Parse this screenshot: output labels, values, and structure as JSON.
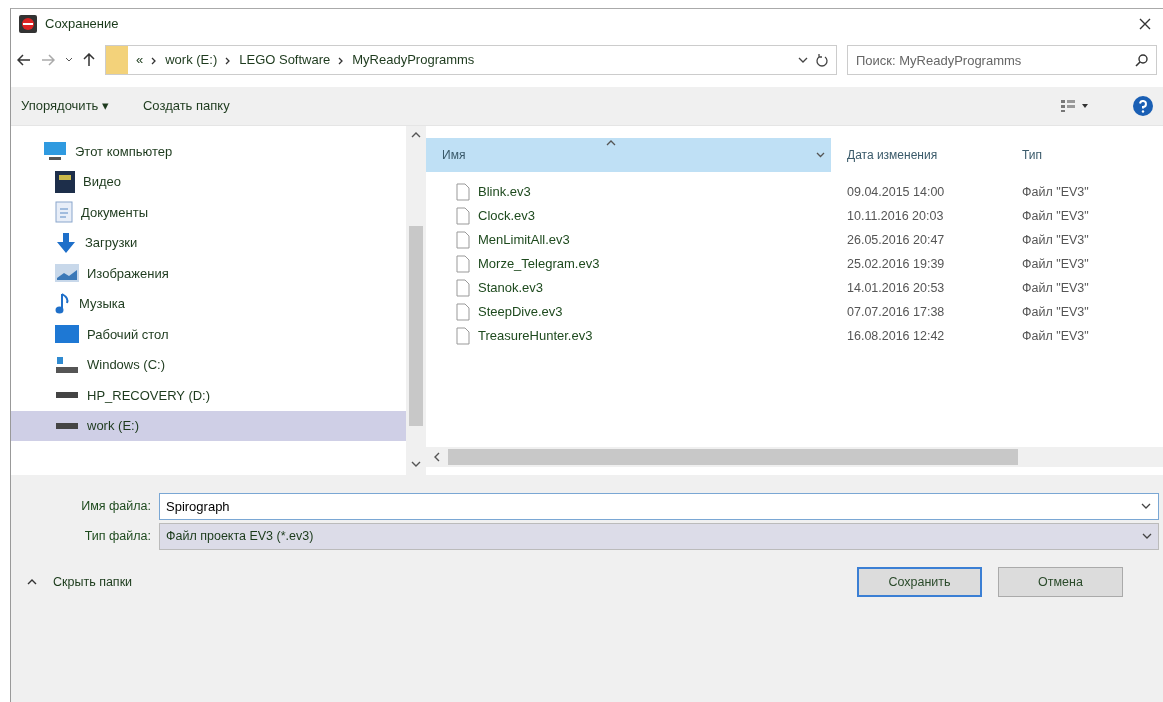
{
  "window": {
    "title": "Сохранение"
  },
  "address_bar": {
    "overflow": "«",
    "path": [
      "work (E:)",
      "LEGO Software",
      "MyReadyProgramms"
    ]
  },
  "search": {
    "placeholder": "Поиск: MyReadyProgramms"
  },
  "toolbar": {
    "organize": "Упорядочить ▾",
    "new_folder": "Создать папку"
  },
  "sidebar": {
    "items": [
      {
        "label": "Этот компьютер",
        "kind": "computer",
        "selected": false,
        "children": [
          {
            "label": "Видео",
            "kind": "video",
            "selected": false
          },
          {
            "label": "Документы",
            "kind": "document",
            "selected": false
          },
          {
            "label": "Загрузки",
            "kind": "download",
            "selected": false
          },
          {
            "label": "Изображения",
            "kind": "image",
            "selected": false
          },
          {
            "label": "Музыка",
            "kind": "music",
            "selected": false
          },
          {
            "label": "Рабочий стол",
            "kind": "desktop",
            "selected": false
          },
          {
            "label": "Windows (C:)",
            "kind": "system-drive",
            "selected": false
          },
          {
            "label": "HP_RECOVERY (D:)",
            "kind": "drive",
            "selected": false
          },
          {
            "label": "work (E:)",
            "kind": "drive",
            "selected": true
          }
        ]
      }
    ]
  },
  "table": {
    "columns": [
      {
        "label": "Имя",
        "sorted": true
      },
      {
        "label": "Дата изменения",
        "sorted": false
      },
      {
        "label": "Тип",
        "sorted": false
      }
    ],
    "rows": [
      {
        "name": "Blink.ev3",
        "date": "09.04.2015 14:00",
        "type": "Файл \"EV3\""
      },
      {
        "name": "Clock.ev3",
        "date": "10.11.2016 20:03",
        "type": "Файл \"EV3\""
      },
      {
        "name": "MenLimitAll.ev3",
        "date": "26.05.2016 20:47",
        "type": "Файл \"EV3\""
      },
      {
        "name": "Morze_Telegram.ev3",
        "date": "25.02.2016 19:39",
        "type": "Файл \"EV3\""
      },
      {
        "name": "Stanok.ev3",
        "date": "14.01.2016 20:53",
        "type": "Файл \"EV3\""
      },
      {
        "name": "SteepDive.ev3",
        "date": "07.07.2016 17:38",
        "type": "Файл \"EV3\""
      },
      {
        "name": "TreasureHunter.ev3",
        "date": "16.08.2016 12:42",
        "type": "Файл \"EV3\""
      }
    ]
  },
  "file_name": {
    "label": "Имя файла:",
    "value": "Spirograph"
  },
  "file_type": {
    "label": "Тип файла:",
    "value": "Файл проекта EV3 (*.ev3)"
  },
  "hide_folders": "Скрыть папки",
  "buttons": [
    {
      "label": "Сохранить",
      "default": true
    },
    {
      "label": "Отмена",
      "default": false
    }
  ]
}
